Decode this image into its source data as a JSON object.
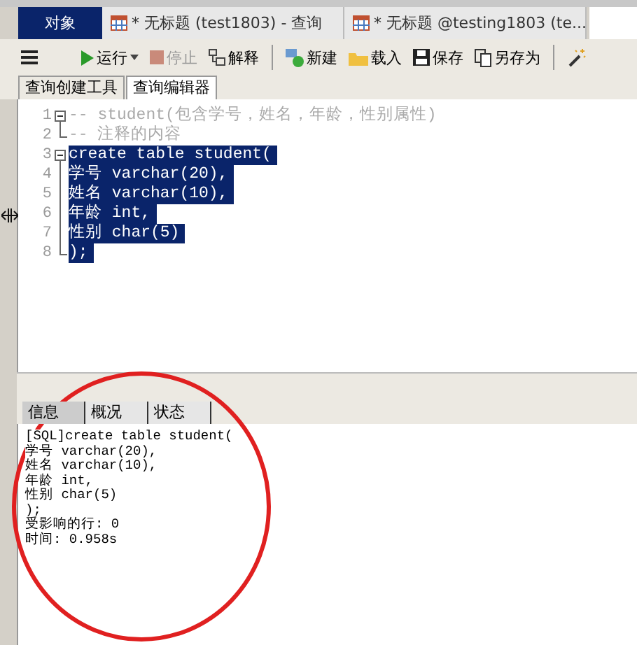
{
  "tabs": [
    {
      "kind": "object",
      "label": "对象",
      "selected": true
    },
    {
      "kind": "query",
      "label": "* 无标题 (test1803) - 查询",
      "selected": false
    },
    {
      "kind": "query",
      "label": "* 无标题 @testing1803 (te...",
      "selected": false
    }
  ],
  "toolbar": [
    {
      "kind": "menu"
    },
    {
      "kind": "run",
      "label": "运行",
      "disabled": false
    },
    {
      "kind": "stop",
      "label": "停止",
      "disabled": true
    },
    {
      "kind": "explain",
      "label": "解释",
      "disabled": false
    },
    {
      "kind": "separator"
    },
    {
      "kind": "new",
      "label": "新建",
      "disabled": false
    },
    {
      "kind": "load",
      "label": "载入",
      "disabled": false
    },
    {
      "kind": "save",
      "label": "保存",
      "disabled": false
    },
    {
      "kind": "saveas",
      "label": "另存为",
      "disabled": false
    },
    {
      "kind": "separator"
    },
    {
      "kind": "beautify"
    }
  ],
  "editor_tabs": [
    {
      "label": "查询创建工具",
      "selected": false
    },
    {
      "label": "查询编辑器",
      "selected": true
    }
  ],
  "editor_lines": [
    {
      "number": "1",
      "text": "-- student(包含学号，姓名，年龄，性别属性)",
      "kind": "comment",
      "fold_start": true,
      "fold_end": false,
      "selected": false
    },
    {
      "number": "2",
      "text": "-- 注释的内容",
      "kind": "comment",
      "fold_start": false,
      "fold_end": true,
      "selected": false
    },
    {
      "number": "3",
      "text": "create table student(",
      "kind": "code",
      "fold_start": true,
      "fold_end": false,
      "selected": true
    },
    {
      "number": "4",
      "text": "学号 varchar(20),",
      "kind": "code",
      "fold_start": false,
      "fold_end": false,
      "selected": true
    },
    {
      "number": "5",
      "text": "姓名 varchar(10),",
      "kind": "code",
      "fold_start": false,
      "fold_end": false,
      "selected": true
    },
    {
      "number": "6",
      "text": "年龄 int,",
      "kind": "code",
      "fold_start": false,
      "fold_end": false,
      "selected": true
    },
    {
      "number": "7",
      "text": "性别 char(5)",
      "kind": "code",
      "fold_start": false,
      "fold_end": false,
      "selected": true
    },
    {
      "number": "8",
      "text": ");",
      "kind": "code",
      "fold_start": false,
      "fold_end": true,
      "selected": true
    }
  ],
  "result_tabs": [
    {
      "label": "信息",
      "selected": true
    },
    {
      "label": "概况",
      "selected": false
    },
    {
      "label": "状态",
      "selected": false
    }
  ],
  "output_lines": [
    "[SQL]create table student(",
    "学号 varchar(20),",
    "姓名 varchar(10),",
    "年龄 int,",
    "性别 char(5)",
    ");",
    "受影响的行: 0",
    "时间: 0.958s"
  ]
}
